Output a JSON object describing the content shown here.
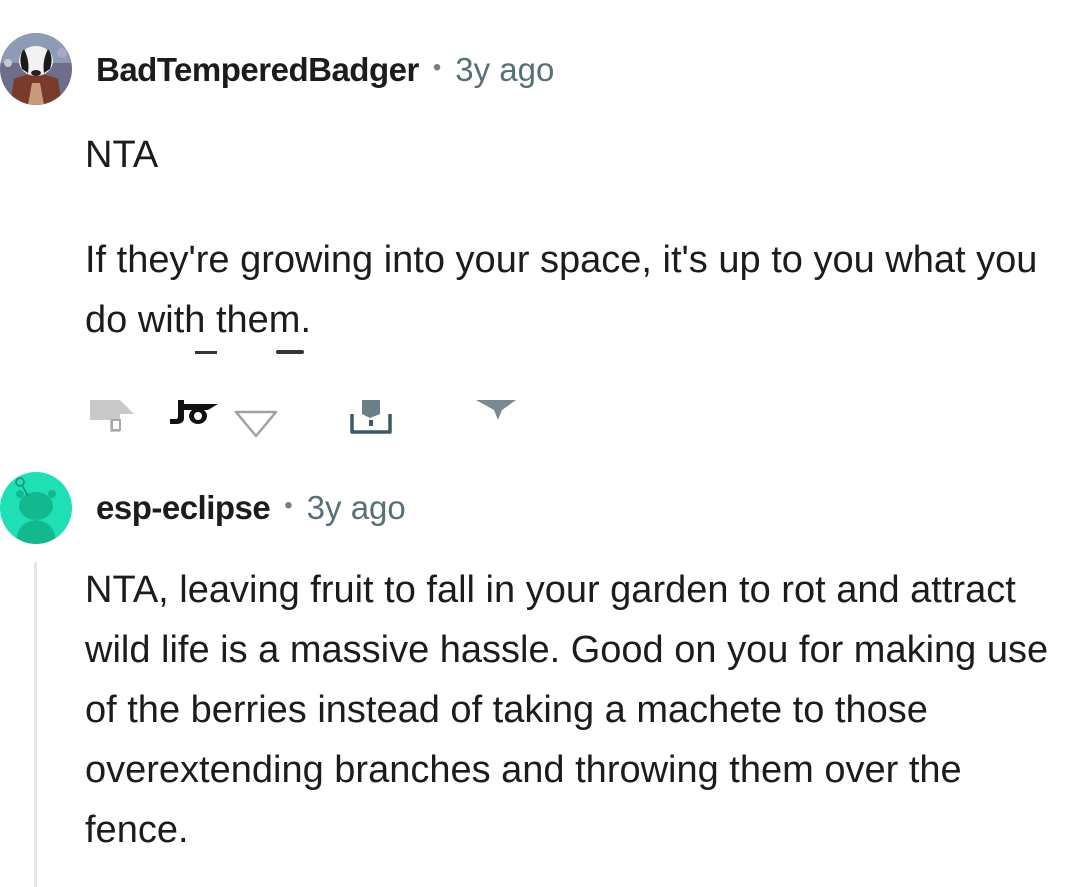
{
  "comments": [
    {
      "username": "BadTemperedBadger",
      "separator": "•",
      "time": "3y ago",
      "avatar_icon": "badger-avatar-icon",
      "body_line1": "NTA",
      "body_line2": "If they're growing into your space, it's up to you what you do with them."
    },
    {
      "username": "esp-eclipse",
      "separator": "•",
      "time": "3y ago",
      "avatar_icon": "snoo-avatar-icon",
      "body": "NTA, leaving fruit to fall in your garden to rot and attract wild life is a massive hassle. Good on you for making use of the berries instead of taking a machete to those overextending branches and throwing them over the fence."
    }
  ],
  "actions": {
    "reply_icon": "reply-icon",
    "vote_count_text": "Jo",
    "downvote_icon": "downvote-icon",
    "share_icon": "share-icon",
    "more_icon": "more-options-icon"
  },
  "colors": {
    "username": "#1c1c1c",
    "time": "#576f76",
    "snoo_bg": "#1ee0b4",
    "thread_line": "#e5e5e5"
  }
}
